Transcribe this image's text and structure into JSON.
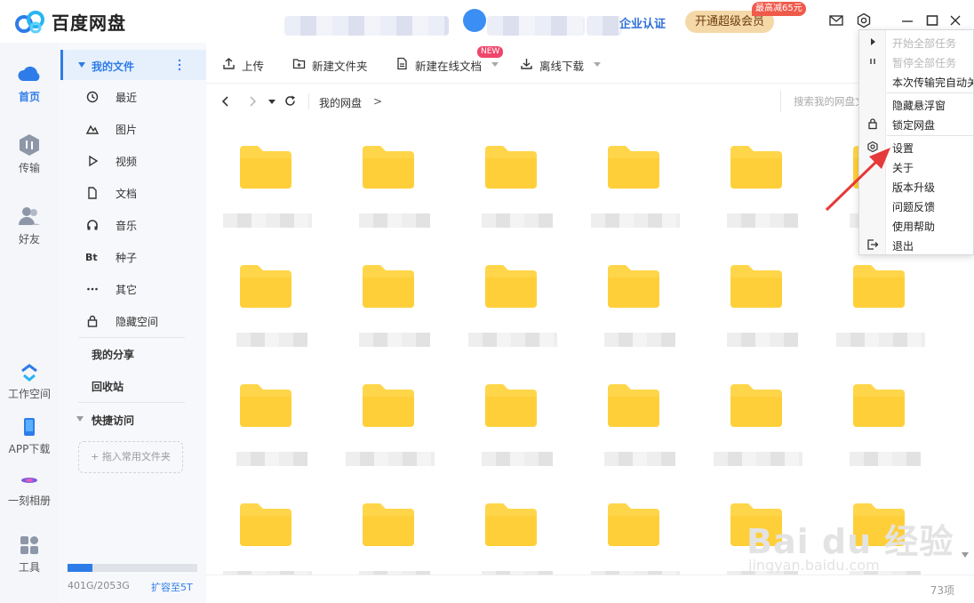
{
  "app": {
    "title": "百度网盘"
  },
  "header": {
    "enterprise_label": "企业认证",
    "vip_button": "开通超级会员",
    "vip_badge": "最高减65元",
    "icons": [
      "mail-icon",
      "gear-icon",
      "minimize-icon",
      "maximize-icon",
      "close-icon"
    ]
  },
  "leftnav": {
    "items": [
      {
        "label": "首页",
        "icon": "cloud-icon",
        "active": true
      },
      {
        "label": "传输",
        "icon": "transfer-icon"
      },
      {
        "label": "好友",
        "icon": "friends-icon"
      },
      {
        "label": "工作空间",
        "icon": "workspace-icon"
      },
      {
        "label": "APP下载",
        "icon": "phone-icon"
      },
      {
        "label": "一刻相册",
        "icon": "album-icon"
      },
      {
        "label": "工具",
        "icon": "tools-icon"
      }
    ]
  },
  "sidebar": {
    "header": "我的文件",
    "items": [
      {
        "label": "最近",
        "icon": "clock-icon"
      },
      {
        "label": "图片",
        "icon": "image-icon"
      },
      {
        "label": "视频",
        "icon": "video-icon"
      },
      {
        "label": "文档",
        "icon": "document-icon"
      },
      {
        "label": "音乐",
        "icon": "headphones-icon"
      },
      {
        "label": "种子",
        "icon": "bt-icon"
      },
      {
        "label": "其它",
        "icon": "more-icon"
      },
      {
        "label": "隐藏空间",
        "icon": "lock-icon"
      }
    ],
    "my_share": "我的分享",
    "recycle": "回收站",
    "quick_access": "快捷访问",
    "drop_hint": "+ 拖入常用文件夹",
    "quota_text": "401G/2053G",
    "quota_fraction": 0.195,
    "expand_link": "扩容至5T"
  },
  "toolbar": {
    "upload": "上传",
    "new_folder": "新建文件夹",
    "new_doc": "新建在线文档",
    "new_badge": "NEW",
    "offline_download": "离线下载"
  },
  "address": {
    "breadcrumb": "我的网盘",
    "separator": ">",
    "search_placeholder": "搜索我的网盘文件"
  },
  "grid": {
    "rows": 4,
    "cols": 6,
    "item_count": "73项"
  },
  "menu": {
    "items": [
      {
        "label": "开始全部任务",
        "icon": "play-icon",
        "disabled": true
      },
      {
        "label": "暂停全部任务",
        "icon": "pause-icon",
        "disabled": true
      },
      {
        "label": "本次传输完自动关机",
        "icon": "",
        "disabled": false
      },
      {
        "label": "隐藏悬浮窗",
        "icon": "",
        "disabled": false
      },
      {
        "label": "锁定网盘",
        "icon": "lock-icon",
        "disabled": false
      },
      {
        "label": "设置",
        "icon": "gear-icon",
        "disabled": false
      },
      {
        "label": "关于",
        "icon": "",
        "disabled": false
      },
      {
        "label": "版本升级",
        "icon": "",
        "disabled": false
      },
      {
        "label": "问题反馈",
        "icon": "",
        "disabled": false
      },
      {
        "label": "使用帮助",
        "icon": "",
        "disabled": false
      },
      {
        "label": "退出",
        "icon": "exit-icon",
        "disabled": false
      }
    ]
  },
  "watermark": {
    "main": "Bai du 经验",
    "sub": "jingyan.baidu.com"
  },
  "colors": {
    "accent": "#2e7ce8",
    "folder": "#ffd54a",
    "vip": "#f5d8a8",
    "arrow": "#e5393a"
  }
}
